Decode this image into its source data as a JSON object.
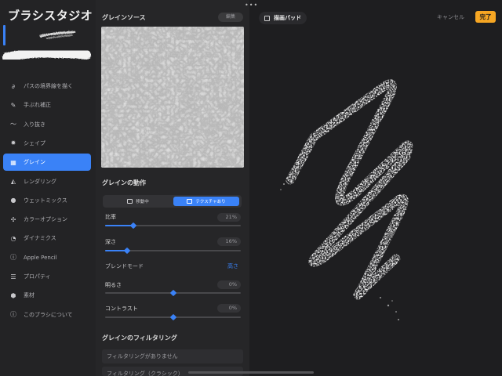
{
  "app_title": "ブラシスタジオ",
  "top_dots": "•••",
  "sidebar": {
    "items": [
      {
        "icon": "path-icon",
        "glyph": "∂",
        "label": "パスの境界線を描く",
        "active": false
      },
      {
        "icon": "stabilization-icon",
        "glyph": "✎",
        "label": "手ぶれ補正",
        "active": false
      },
      {
        "icon": "taper-icon",
        "glyph": "〜",
        "label": "入り抜き",
        "active": false
      },
      {
        "icon": "shape-icon",
        "glyph": "✹",
        "label": "シェイプ",
        "active": false
      },
      {
        "icon": "grain-icon",
        "glyph": "▦",
        "label": "グレイン",
        "active": true
      },
      {
        "icon": "rendering-icon",
        "glyph": "◭",
        "label": "レンダリング",
        "active": false
      },
      {
        "icon": "wet-mix-icon",
        "glyph": "●",
        "label": "ウェットミックス",
        "active": false
      },
      {
        "icon": "color-dynamics-icon",
        "glyph": "✣",
        "label": "カラーオプション",
        "active": false
      },
      {
        "icon": "dynamics-icon",
        "glyph": "◔",
        "label": "ダイナミクス",
        "active": false
      },
      {
        "icon": "apple-pencil-icon",
        "glyph": "ⓘ",
        "label": "Apple Pencil",
        "active": false
      },
      {
        "icon": "properties-icon",
        "glyph": "☰",
        "label": "プロパティ",
        "active": false
      },
      {
        "icon": "material-icon",
        "glyph": "⬢",
        "label": "素材",
        "active": false
      },
      {
        "icon": "about-icon",
        "glyph": "ⓘ",
        "label": "このブラシについて",
        "active": false
      }
    ]
  },
  "panel": {
    "grain_source_title": "グレインソース",
    "edit_label": "編集",
    "grain_behavior_title": "グレインの動作",
    "segmented": {
      "option_moving": "移動中",
      "option_texturized": "テクスチャあり",
      "selected": "テクスチャあり"
    },
    "scale": {
      "label": "比率",
      "value": "21%",
      "level": 0.21
    },
    "depth": {
      "label": "深さ",
      "value": "16%",
      "level": 0.16
    },
    "blend_mode": {
      "label": "ブレンドモード",
      "value": "高さ"
    },
    "brightness": {
      "label": "明るさ",
      "value": "0%",
      "level": 0.5
    },
    "contrast": {
      "label": "コントラスト",
      "value": "0%",
      "level": 0.5
    },
    "filtering_title": "グレインのフィルタリング",
    "filtering_options": [
      "フィルタリングがありません",
      "フィルタリング（クラシック）"
    ]
  },
  "pad": {
    "tag_label": "描画パッド",
    "cancel_label": "キャンセル",
    "done_label": "完了"
  },
  "colors": {
    "accent": "#3a82f7",
    "done": "#f6a623",
    "background": "#1c1c1e"
  }
}
